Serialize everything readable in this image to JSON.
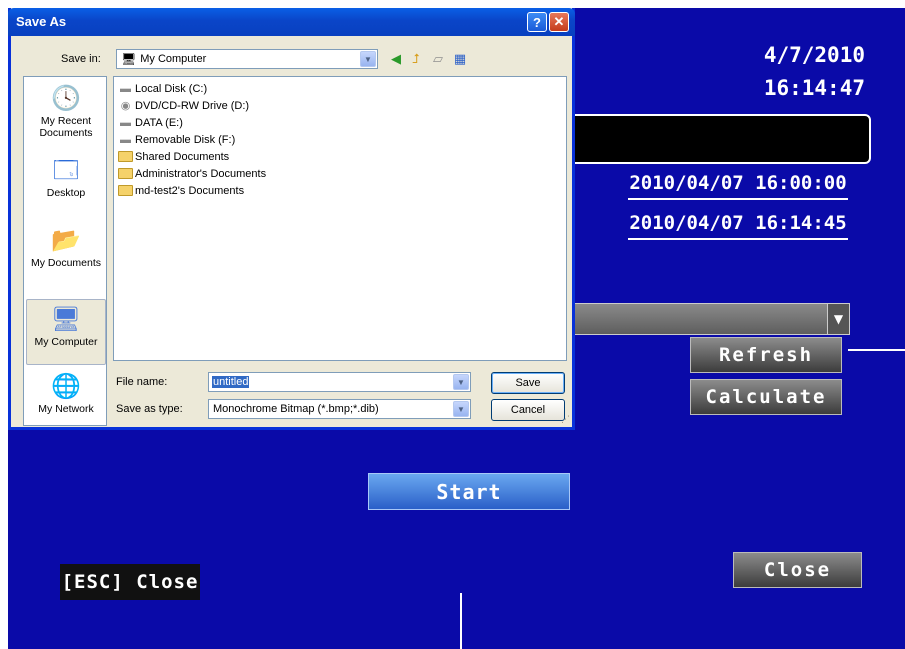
{
  "dvr": {
    "date": "4/7/2010",
    "time": "16:14:47",
    "start_time": "2010/04/07 16:00:00",
    "end_time": "2010/04/07 16:14:45",
    "refresh_label": "Refresh",
    "calculate_label": "Calculate",
    "start_label": "Start",
    "esc_close_label": "[ESC] Close",
    "close_label": "Close"
  },
  "dialog": {
    "title": "Save As",
    "help_glyph": "?",
    "close_glyph": "✕",
    "save_in_label": "Save in:",
    "save_in_value": "My Computer",
    "places": [
      {
        "label": "My Recent Documents",
        "icon": "recent-documents-icon"
      },
      {
        "label": "Desktop",
        "icon": "desktop-icon"
      },
      {
        "label": "My Documents",
        "icon": "my-documents-icon"
      },
      {
        "label": "My Computer",
        "icon": "my-computer-icon"
      },
      {
        "label": "My Network",
        "icon": "my-network-icon"
      }
    ],
    "files": [
      {
        "name": "Local Disk (C:)",
        "icon": "drive-icon"
      },
      {
        "name": "DVD/CD-RW Drive (D:)",
        "icon": "dvd-drive-icon"
      },
      {
        "name": "DATA (E:)",
        "icon": "drive-icon"
      },
      {
        "name": "Removable Disk (F:)",
        "icon": "removable-drive-icon"
      },
      {
        "name": "Shared Documents",
        "icon": "folder-icon"
      },
      {
        "name": "Administrator's Documents",
        "icon": "folder-icon"
      },
      {
        "name": "md-test2's Documents",
        "icon": "folder-icon"
      }
    ],
    "file_name_label": "File name:",
    "file_name_value": "untitled",
    "save_as_type_label": "Save as type:",
    "save_as_type_value": "Monochrome Bitmap (*.bmp;*.dib)",
    "save_label": "Save",
    "cancel_label": "Cancel"
  }
}
